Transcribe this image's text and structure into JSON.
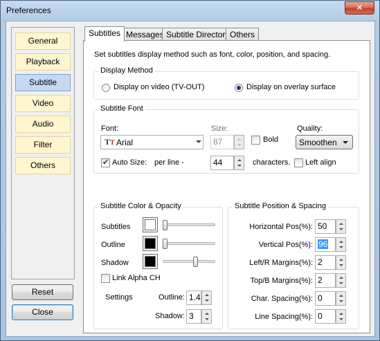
{
  "window": {
    "title": "Preferences",
    "close_glyph": "✕"
  },
  "nav": {
    "items": [
      {
        "label": "General"
      },
      {
        "label": "Playback"
      },
      {
        "label": "Subtitle"
      },
      {
        "label": "Video"
      },
      {
        "label": "Audio"
      },
      {
        "label": "Filter"
      },
      {
        "label": "Others"
      }
    ],
    "selected": "Subtitle",
    "reset_label": "Reset",
    "close_label": "Close"
  },
  "tabs": [
    {
      "label": "Subtitles"
    },
    {
      "label": "Messages"
    },
    {
      "label": "Subtitle Directory"
    },
    {
      "label": "Others"
    }
  ],
  "active_tab": "Subtitles",
  "description": "Set subtitles display method such as font, color, position, and spacing.",
  "display_method": {
    "title": "Display Method",
    "option_video": "Display on video (TV-OUT)",
    "option_overlay": "Display on overlay surface",
    "selected": "overlay"
  },
  "subtitle_font": {
    "title": "Subtitle Font",
    "font_label": "Font:",
    "font_value": "Arial",
    "font_icon": "truetype-icon",
    "size_label": "Size:",
    "size_value": "87",
    "bold_label": "Bold",
    "bold_checked": false,
    "quality_label": "Quality:",
    "quality_value": "Smoothen",
    "autosize_label": "Auto Size:",
    "autosize_checked": true,
    "per_line_label": "per line -",
    "per_line_value": "44",
    "characters_label": "characters.",
    "left_align_label": "Left align",
    "left_align_checked": false
  },
  "color_opacity": {
    "title": "Subtitle Color & Opacity",
    "subtitles_label": "Subtitles",
    "subtitles_color": "#ffffff",
    "outline_label": "Outline",
    "outline_color": "#000000",
    "shadow_label": "Shadow",
    "shadow_color": "#000000",
    "link_alpha_label": "Link Alpha CH",
    "link_alpha_checked": false,
    "settings_label": "Settings",
    "outline_setting_label": "Outline:",
    "outline_setting_value": "1.4",
    "shadow_setting_label": "Shadow:",
    "shadow_setting_value": "3"
  },
  "position_spacing": {
    "title": "Subtitle Position & Spacing",
    "fields": [
      {
        "label": "Horizontal Pos(%):",
        "value": "50"
      },
      {
        "label": "Vertical Pos(%):",
        "value": "96"
      },
      {
        "label": "Left/R Margins(%):",
        "value": "2"
      },
      {
        "label": "Top/B Margins(%):",
        "value": "2"
      },
      {
        "label": "Char. Spacing(%):",
        "value": "0"
      },
      {
        "label": "Line Spacing(%):",
        "value": "0"
      }
    ]
  }
}
